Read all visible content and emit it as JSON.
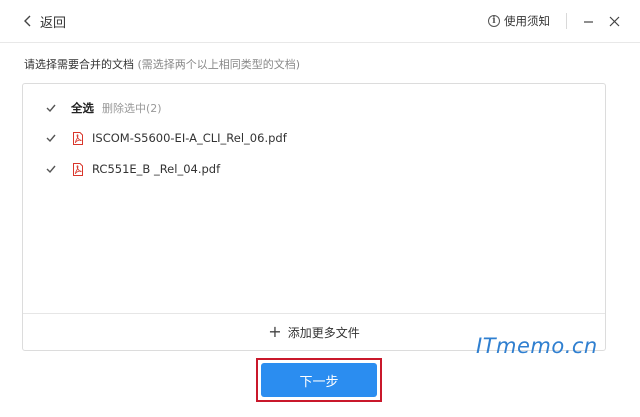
{
  "titlebar": {
    "back_label": "返回",
    "help_label": "使用须知"
  },
  "instruction": {
    "text": "请选择需要合并的文档",
    "hint": "(需选择两个以上相同类型的文档)"
  },
  "file_list": {
    "select_all_label": "全选",
    "delete_selected_label": "删除选中(2)",
    "files": [
      {
        "name": "ISCOM-S5600-EI-A_CLI_Rel_06.pdf",
        "checked": true
      },
      {
        "name": "RC551E_B _Rel_04.pdf",
        "checked": true
      }
    ],
    "add_more_label": "添加更多文件"
  },
  "next_button": {
    "label": "下一步"
  },
  "watermark": "ITmemo.cn",
  "colors": {
    "accent": "#2b8df0",
    "highlight_border": "#c9182b",
    "pdf_icon": "#d9362b"
  }
}
